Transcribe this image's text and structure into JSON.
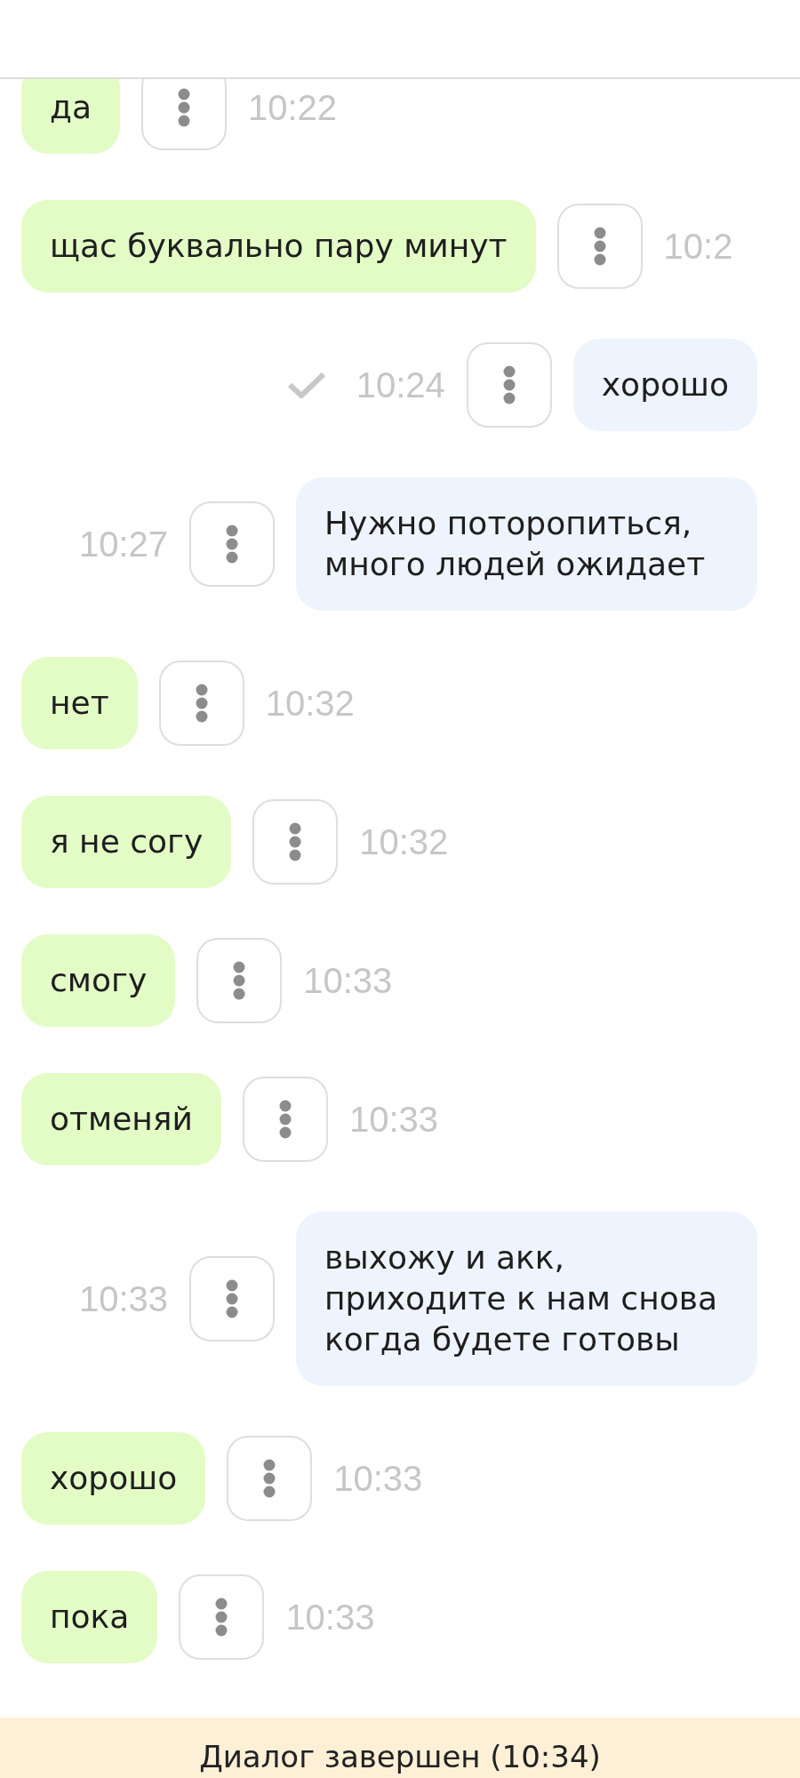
{
  "messages": [
    {
      "kind": "client",
      "text": "да",
      "time": "10:22"
    },
    {
      "kind": "client",
      "text": "щас буквально пару минут",
      "time": "10:2"
    },
    {
      "kind": "operator",
      "text": "хорошо",
      "time": "10:24",
      "read": true
    },
    {
      "kind": "operator",
      "text": "Нужно поторопиться, много людей ожидает",
      "time": "10:27",
      "read": false
    },
    {
      "kind": "client",
      "text": "нет",
      "time": "10:32"
    },
    {
      "kind": "client",
      "text": "я не согу",
      "time": "10:32"
    },
    {
      "kind": "client",
      "text": "смогу",
      "time": "10:33"
    },
    {
      "kind": "client",
      "text": "отменяй",
      "time": "10:33"
    },
    {
      "kind": "operator",
      "text": "выхожу и акк, приходите к нам снова когда будете готовы",
      "time": "10:33",
      "read": false
    },
    {
      "kind": "client",
      "text": "хорошо",
      "time": "10:33"
    },
    {
      "kind": "client",
      "text": "пока",
      "time": "10:33"
    }
  ],
  "status_bar": {
    "text": "Диалог завершен (10:34)"
  }
}
